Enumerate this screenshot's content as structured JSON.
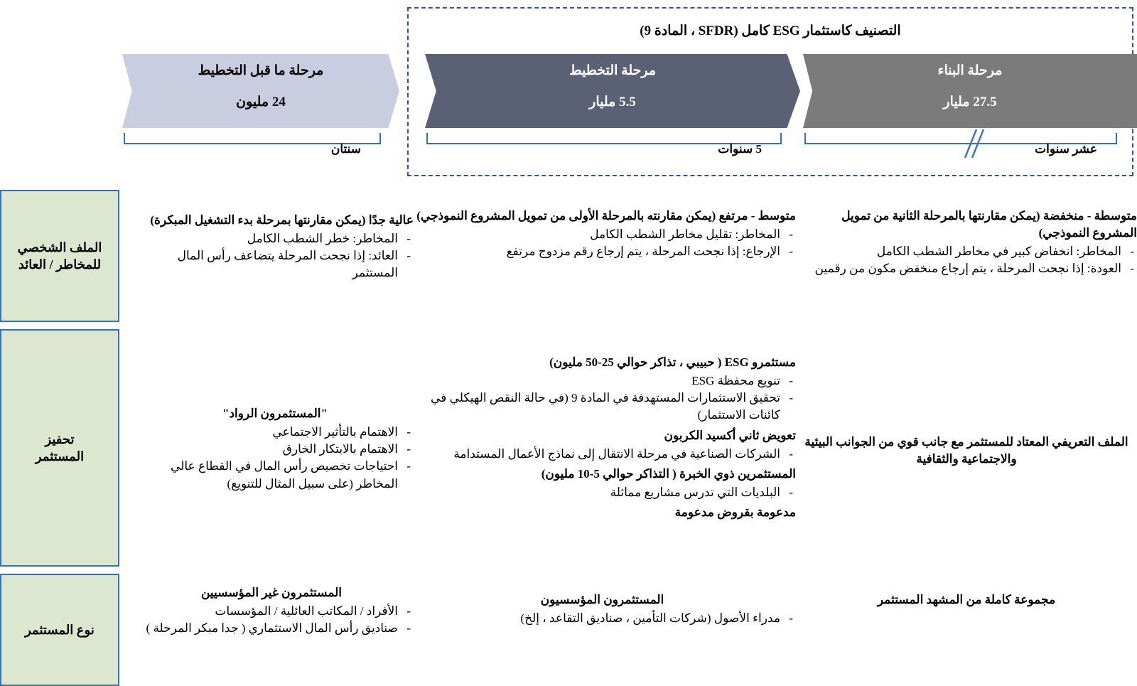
{
  "esg_band": {
    "caption": "التصنيف كاستثمار ESG كامل (SFDR ، المادة 9)",
    "border_color": "#2f5496"
  },
  "phases": [
    {
      "id": "pre-planning",
      "title": "مرحلة ما قبل التخطيط",
      "amount": "24 مليون",
      "duration_label": "سنتان",
      "fill": "#c8cedf",
      "text_color": "#000000"
    },
    {
      "id": "planning",
      "title": "مرحلة التخطيط",
      "amount": "5.5 مليار",
      "duration_label": "5 سنوات",
      "fill": "#5b6175",
      "text_color": "#ffffff"
    },
    {
      "id": "construction",
      "title": "مرحلة البناء",
      "amount": "27.5 مليار",
      "duration_label": "عشر سنوات",
      "fill": "#7b7b7b",
      "text_color": "#ffffff"
    }
  ],
  "categories": [
    {
      "id": "risk-return",
      "label": "الملف الشخصي\nللمخاطر / العائد"
    },
    {
      "id": "investor-motivation",
      "label": "تحفيز\nالمستثمر"
    },
    {
      "id": "investor-type",
      "label": "نوع المستثمر"
    }
  ],
  "rows": [
    {
      "id": "risk-return",
      "cells": [
        {
          "column": "pre-planning",
          "heading": "عالية جدًا (يمكن مقارنتها بمرحلة بدء التشغيل المبكرة)",
          "bullets": [
            "المخاطر: خطر الشطب الكامل",
            "العائد: إذا نجحت المرحلة يتضاعف رأس المال المستثمر"
          ]
        },
        {
          "column": "planning",
          "heading": "متوسط - مرتفع (يمكن مقارنته بالمرحلة الأولى من تمويل المشروع النموذجي)",
          "bullets": [
            "المخاطر: تقليل مخاطر الشطب الكامل",
            "الإرجاع: إذا نجحت المرحلة ، يتم إرجاع رقم مزدوج مرتفع"
          ]
        },
        {
          "column": "construction",
          "heading": "متوسطة - منخفضة (يمكن مقارنتها بالمرحلة الثانية من تمويل المشروع النموذجي)",
          "bullets": [
            "المخاطر: انخفاض كبير في مخاطر الشطب الكامل",
            "العودة: إذا نجحت المرحلة ، يتم إرجاع منخفض مكون من رقمين"
          ]
        }
      ]
    },
    {
      "id": "investor-motivation",
      "cells": [
        {
          "column": "pre-planning",
          "heading": "\"المستثمرون الرواد\"",
          "bullets": [
            "الاهتمام بالتأثير الاجتماعي",
            "الاهتمام بالابتكار الخارق",
            "احتياجات تخصيص رأس المال في القطاع عالي المخاطر (على سبيل المثال للتنويع)"
          ]
        },
        {
          "column": "planning",
          "groups": [
            {
              "heading": "مستثمرو ESG ( حبيبي ، تذاكر حوالي 25-50 مليون)",
              "bullets": [
                "تنويع محفظة ESG",
                "تحقيق الاستثمارات المستهدفة في المادة 9 (في حالة النقص الهيكلي في كائنات الاستثمار)"
              ]
            },
            {
              "heading": "تعويض ثاني أكسيد الكربون",
              "bullets": [
                "الشركات الصناعية في مرحلة الانتقال إلى نماذج الأعمال المستدامة"
              ]
            },
            {
              "heading": "المستثمرين ذوي الخبرة ( التذاكر حوالي 5-10 مليون)",
              "bullets": [
                "البلديات التي تدرس مشاريع مماثلة"
              ]
            },
            {
              "heading": "مدعومة بقروض مدعومة",
              "bullets": []
            }
          ]
        },
        {
          "column": "construction",
          "heading": "الملف التعريفي المعتاد للمستثمر مع جانب قوي من الجوانب البيئية والاجتماعية والثقافية"
        }
      ]
    },
    {
      "id": "investor-type",
      "cells": [
        {
          "column": "pre-planning",
          "heading": "المستثمرون غير المؤسسيين",
          "bullets": [
            "الأفراد / المكاتب العائلية / المؤسسات",
            "صناديق رأس المال الاستثماري ( جدا مبكر المرحلة )"
          ]
        },
        {
          "column": "planning",
          "heading": "المستثمرون المؤسسيون",
          "bullets": [
            "مدراء الأصول (شركات التأمين ، صناديق التقاعد ، إلخ)"
          ]
        },
        {
          "column": "construction",
          "heading": "مجموعة كاملة من المشهد المستثمر"
        }
      ]
    }
  ]
}
